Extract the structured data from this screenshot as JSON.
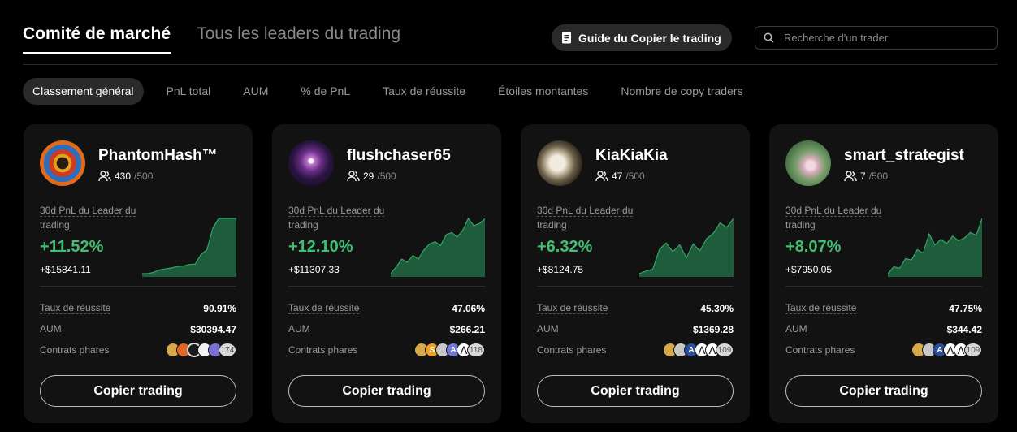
{
  "tabs": [
    {
      "label": "Comité de marché"
    },
    {
      "label": "Tous les leaders du trading"
    }
  ],
  "guide_button": {
    "label": "Guide du Copier le trading",
    "icon": "document-icon"
  },
  "search": {
    "placeholder": "Recherche d'un trader",
    "value": "",
    "icon": "search-icon"
  },
  "subtabs": [
    {
      "label": "Classement général"
    },
    {
      "label": "PnL total"
    },
    {
      "label": "AUM"
    },
    {
      "label": "% de PnL"
    },
    {
      "label": "Taux de réussite"
    },
    {
      "label": "Étoiles montantes"
    },
    {
      "label": "Nombre de copy traders"
    }
  ],
  "labels": {
    "pnl_label": "30d PnL du Leader du trading",
    "win_rate_label": "Taux de réussite",
    "aum_label": "AUM",
    "contracts_label": "Contrats phares",
    "copy_button": "Copier trading"
  },
  "colors": {
    "positive": "#3fbf6f",
    "chart_fill": "#1f5c3c",
    "chart_line": "#2fa865"
  },
  "traders": [
    {
      "name": "PhantomHash™",
      "followers": "430",
      "followers_max": "/500",
      "pnl_pct": "+11.52%",
      "pnl_usd": "+$15841.11",
      "win_rate": "90.91%",
      "aum": "$30394.47",
      "contracts_more": "174",
      "coin_icons": [
        "doge-coin-icon",
        "shib-coin-icon",
        "cyber-coin-icon",
        "cardano-coin-icon",
        "rocket-coin-icon"
      ],
      "sparkline": [
        0,
        0,
        0.3,
        0.8,
        1.0,
        1.2,
        1.5,
        1.6,
        1.9,
        2.0,
        4.0,
        5.0,
        9.5,
        11.52,
        11.52,
        11.52,
        11.52
      ]
    },
    {
      "name": "flushchaser65",
      "followers": "29",
      "followers_max": "/500",
      "pnl_pct": "+12.10%",
      "pnl_usd": "+$11307.33",
      "win_rate": "47.06%",
      "aum": "$266.21",
      "contracts_more": "118",
      "coin_icons": [
        "doge-coin-icon",
        "sand-coin-icon",
        "silver-coin-icon",
        "aptos-coin-icon",
        "arbitrum-coin-icon"
      ],
      "sparkline": [
        0,
        1.5,
        3.2,
        2.5,
        4.0,
        3.2,
        5.2,
        6.5,
        7.0,
        6.2,
        8.5,
        9.0,
        8.0,
        9.5,
        12.1,
        10.5,
        11.0,
        12.0
      ]
    },
    {
      "name": "KiaKiaKia",
      "followers": "47",
      "followers_max": "/500",
      "pnl_pct": "+6.32%",
      "pnl_usd": "+$8124.75",
      "win_rate": "45.30%",
      "aum": "$1369.28",
      "contracts_more": "109",
      "coin_icons": [
        "doge-coin-icon",
        "silver-coin-icon",
        "avalanche-coin-icon",
        "arbitrum-coin-icon",
        "arbitrum-coin-icon"
      ],
      "sparkline": [
        0,
        0.3,
        0.5,
        2.8,
        3.5,
        2.5,
        3.3,
        1.8,
        3.4,
        2.6,
        4.0,
        4.6,
        5.8,
        5.3,
        6.32
      ]
    },
    {
      "name": "smart_strategist",
      "followers": "7",
      "followers_max": "/500",
      "pnl_pct": "+8.07%",
      "pnl_usd": "+$7950.05",
      "win_rate": "47.75%",
      "aum": "$344.42",
      "contracts_more": "109",
      "coin_icons": [
        "doge-coin-icon",
        "silver-coin-icon",
        "avalanche-coin-icon",
        "arbitrum-coin-icon",
        "arbitrum-coin-icon"
      ],
      "sparkline": [
        0,
        1.0,
        0.8,
        2.2,
        2.0,
        3.5,
        3.0,
        5.8,
        4.2,
        5.0,
        4.4,
        5.5,
        4.8,
        5.2,
        6.0,
        5.6,
        8.07
      ]
    }
  ]
}
